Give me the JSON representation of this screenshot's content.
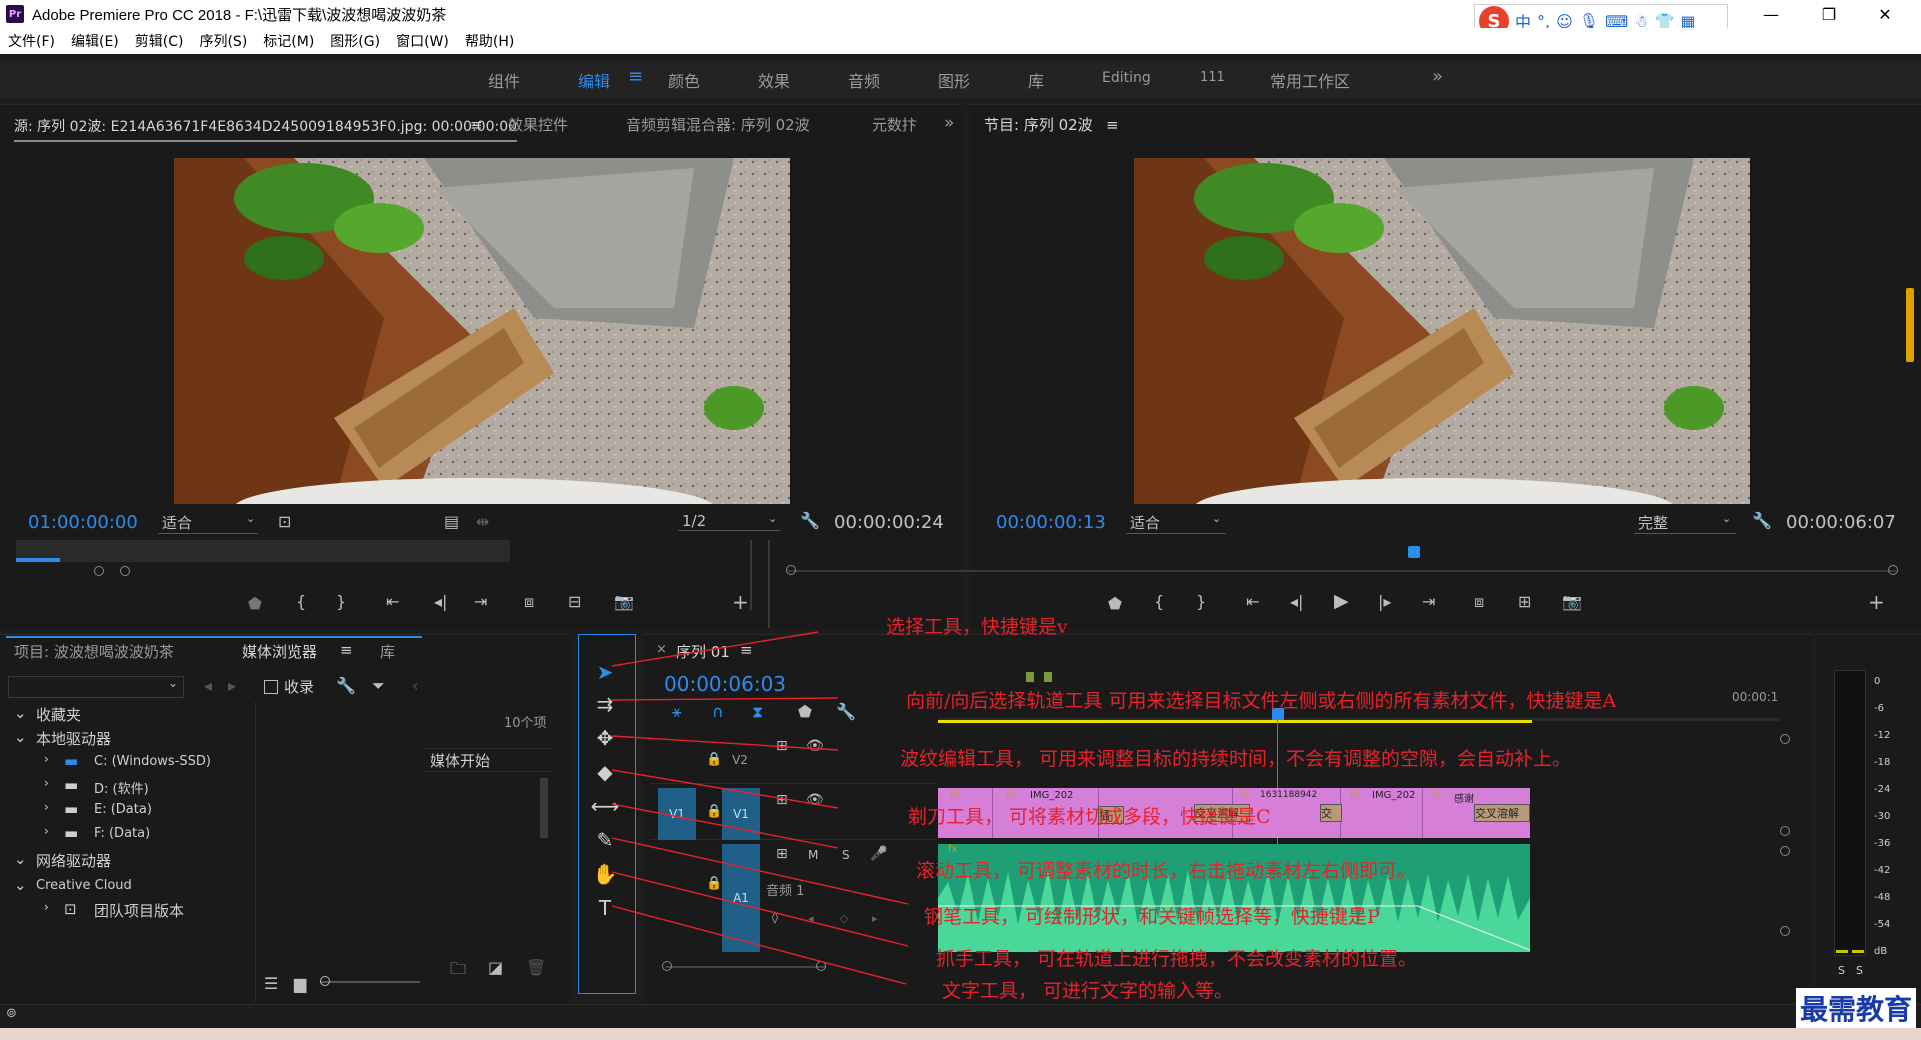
{
  "app": {
    "title": "Adobe Premiere Pro CC 2018 - F:\\迅雷下载\\波波想喝波波奶茶",
    "logo": "Pr",
    "window_controls": {
      "minimize": "—",
      "maximize": "❐",
      "close": "✕"
    }
  },
  "ime": {
    "logo": "S",
    "lang": "中",
    "punct": "°,"
  },
  "menu": [
    "文件(F)",
    "编辑(E)",
    "剪辑(C)",
    "序列(S)",
    "标记(M)",
    "图形(G)",
    "窗口(W)",
    "帮助(H)"
  ],
  "workspaces": {
    "items": [
      "组件",
      "编辑",
      "颜色",
      "效果",
      "音频",
      "图形",
      "库",
      "Editing",
      "111",
      "常用工作区"
    ],
    "active": "编辑",
    "overflow": "»"
  },
  "source_panel": {
    "tabs": [
      "源: 序列 02波: E214A63671F4E8634D245009184953F0.jpg: 00:00:00:00",
      "效果控件",
      "音频剪辑混合器: 序列 02波",
      "元数抃"
    ],
    "menu_icon": "≡",
    "overflow": "»",
    "timecode_left": "01:00:00:00",
    "fit": "适合",
    "resolution": "1/2",
    "timecode_right": "00:00:00:24"
  },
  "program_panel": {
    "tab": "节目: 序列 02波",
    "menu_icon": "≡",
    "timecode_left": "00:00:00:13",
    "fit": "适合",
    "quality": "完整",
    "timecode_right": "00:00:06:07"
  },
  "project_panel": {
    "tabs": [
      "项目: 波波想喝波波奶茶",
      "媒体浏览器",
      "库"
    ],
    "active_tab": "媒体浏览器",
    "ingest": "收录",
    "item_count": "10个项",
    "media_start": "媒体开始",
    "tree": [
      {
        "label": "收藏夹",
        "level": 0
      },
      {
        "label": "本地驱动器",
        "level": 0
      },
      {
        "label": "C: (Windows-SSD)",
        "level": 1
      },
      {
        "label": "D: (软件)",
        "level": 1
      },
      {
        "label": "E: (Data)",
        "level": 1
      },
      {
        "label": "F: (Data)",
        "level": 1
      },
      {
        "label": "网络驱动器",
        "level": 0
      },
      {
        "label": "Creative Cloud",
        "level": 0
      },
      {
        "label": "团队项目版本",
        "level": 1
      }
    ]
  },
  "timeline": {
    "tab": "序列 01",
    "close": "×",
    "timecode": "00:00:06:03",
    "ruler_end": "00:00:1",
    "tracks": {
      "v2": "V2",
      "v1_src": "V1",
      "v1": "V1",
      "a1": "A1",
      "a1_name": "音频 1",
      "m": "M",
      "s": "S"
    },
    "clip_labels": [
      "IMG_202",
      "1631188942",
      "IMG_202",
      "感谢",
      "交叉溶解",
      "交叉溶解",
      "交叉",
      "插"
    ]
  },
  "meter": {
    "ticks": [
      "0",
      "-6",
      "-12",
      "-18",
      "-24",
      "-30",
      "-36",
      "-42",
      "-48",
      "-54",
      "dB"
    ],
    "solo": [
      "S",
      "S"
    ]
  },
  "annotations": [
    "选择工具，快捷键是v",
    "向前/向后选择轨道工具   可用来选择目标文件左侧或右侧的所有素材文件，快捷键是A",
    "波纹编辑工具，   可用来调整目标的持续时间，不会有调整的空隙，会自动补上。",
    "剃刀工具，   可将素材切成多段，快捷键是C",
    "滚动工具，   可调整素材的时长，右击拖动素材左右侧即可。",
    "钢笔工具，   可绘制形状，和关键帧选择等，快捷键是P",
    "抓手工具，   可在轨道上进行拖拽，不会改变素材的位置。",
    "文字工具，   可进行文字的输入等。"
  ],
  "watermark": "最需教育",
  "colors": {
    "accent": "#2d8ceb",
    "annotation": "#e8222a",
    "video_clip": "#d67fd9",
    "audio_clip": "#1f9f76",
    "track_label": "#1f5f88"
  }
}
